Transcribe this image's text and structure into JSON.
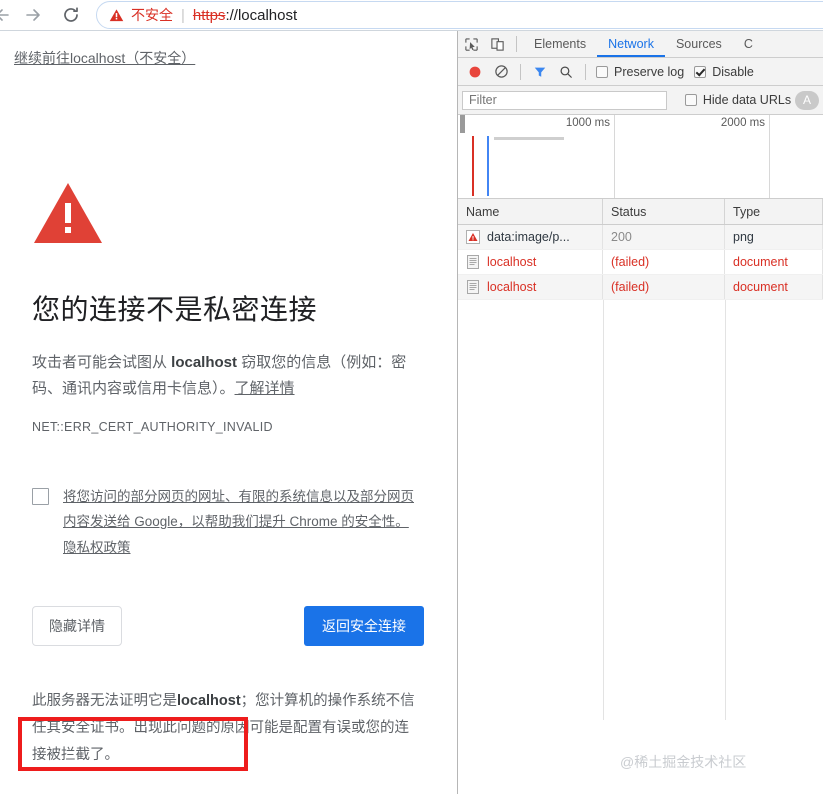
{
  "omnibox": {
    "warning_icon": "warning-triangle-icon",
    "not_secure_label": "不安全",
    "separator": "|",
    "scheme": "https",
    "rest_of_url": "://localhost"
  },
  "nav": {
    "back_icon": "back-arrow-icon",
    "forward_icon": "forward-arrow-icon",
    "reload_icon": "reload-icon"
  },
  "interstitial": {
    "icon": "red-warning-triangle-icon",
    "heading": "您的连接不是私密连接",
    "body_prefix": "攻击者可能会试图从 ",
    "body_host": "localhost",
    "body_middle": " 窃取您的信息（例如：密码、通讯内容或信用卡信息）。",
    "learn_more": "了解详情",
    "error_code": "NET::ERR_CERT_AUTHORITY_INVALID",
    "optin_checked": false,
    "optin_text_line1": "将您访问的部分网页的网址、有限的系统信息以及部分网页",
    "optin_text_line2": "内容发送给 Google，以帮助我们提升 Chrome 的安全性。",
    "privacy_policy": "隐私权政策",
    "hide_details_label": "隐藏详情",
    "back_to_safety_label": "返回安全连接",
    "primary_button_color": "#1a73e8",
    "detail_prefix": "此服务器无法证明它是",
    "detail_host": "localhost",
    "detail_rest": "；您计算机的操作系统不信任其安全证书。出现此问题的原因可能是配置有误或您的连接被拦截了。",
    "proceed_link": "继续前往localhost（不安全）",
    "highlight_color": "#ee1c1c"
  },
  "devtools": {
    "inspect_icon": "inspect-element-icon",
    "device_toolbar_icon": "device-toolbar-icon",
    "tabs": [
      {
        "label": "Elements",
        "active": false
      },
      {
        "label": "Network",
        "active": true
      },
      {
        "label": "Sources",
        "active": false
      },
      {
        "label": "C",
        "active": false
      }
    ],
    "toolbar": {
      "record_icon": "record-button-icon",
      "clear_icon": "clear-icon",
      "filter_icon": "filter-funnel-icon",
      "search_icon": "search-icon",
      "preserve_log_label": "Preserve log",
      "preserve_log_checked": false,
      "disable_cache_label": "Disable",
      "disable_cache_checked": true
    },
    "filter_bar": {
      "placeholder": "Filter",
      "value": "",
      "hide_data_urls_label": "Hide data URLs",
      "hide_data_urls_checked": false,
      "type_pill": "A"
    },
    "overview": {
      "labels": [
        "1000 ms",
        "2000 ms"
      ],
      "event_lines": [
        {
          "color": "#d93025",
          "x": 14
        },
        {
          "color": "#4285f4",
          "x": 29
        }
      ],
      "request_bar_color": "#cfcfcf"
    },
    "table": {
      "columns": [
        "Name",
        "Status",
        "Type"
      ],
      "rows": [
        {
          "icon": "image-warning-icon",
          "name": "data:image/p...",
          "status": "200",
          "type": "png",
          "failed": false
        },
        {
          "icon": "document-icon",
          "name": "localhost",
          "status": "(failed)",
          "type": "document",
          "failed": true
        },
        {
          "icon": "document-icon",
          "name": "localhost",
          "status": "(failed)",
          "type": "document",
          "failed": true
        }
      ]
    }
  },
  "watermark": {
    "text": "@稀土掘金技术社区"
  }
}
